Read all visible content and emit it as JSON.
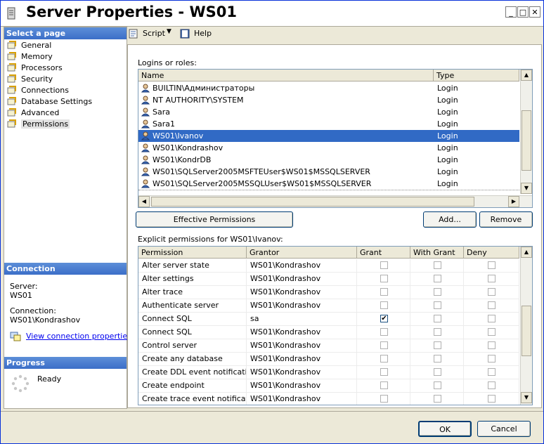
{
  "window": {
    "title": "Server Properties - WS01",
    "controls": {
      "minimize": "_",
      "maximize": "□",
      "close": "✕"
    }
  },
  "left": {
    "select_page_header": "Select a page",
    "pages": [
      {
        "label": "General",
        "icon": "properties-page-icon",
        "selected": false
      },
      {
        "label": "Memory",
        "icon": "properties-page-icon",
        "selected": false
      },
      {
        "label": "Processors",
        "icon": "properties-page-icon",
        "selected": false
      },
      {
        "label": "Security",
        "icon": "properties-page-icon",
        "selected": false
      },
      {
        "label": "Connections",
        "icon": "properties-page-icon",
        "selected": false
      },
      {
        "label": "Database Settings",
        "icon": "properties-page-icon",
        "selected": false
      },
      {
        "label": "Advanced",
        "icon": "properties-page-icon",
        "selected": false
      },
      {
        "label": "Permissions",
        "icon": "properties-page-icon",
        "selected": true
      }
    ],
    "connection": {
      "header": "Connection",
      "server_label": "Server:",
      "server_value": "WS01",
      "connection_label": "Connection:",
      "connection_value": "WS01\\Kondrashov",
      "view_link": "View connection properties"
    },
    "progress": {
      "header": "Progress",
      "status": "Ready"
    }
  },
  "toolbar": {
    "script_label": "Script",
    "help_label": "Help"
  },
  "logins": {
    "label": "Logins or roles:",
    "columns": [
      "Name",
      "Type"
    ],
    "rows": [
      {
        "name": "BUILTIN\\Администраторы",
        "type": "Login"
      },
      {
        "name": "NT AUTHORITY\\SYSTEM",
        "type": "Login"
      },
      {
        "name": "Sara",
        "type": "Login"
      },
      {
        "name": "Sara1",
        "type": "Login"
      },
      {
        "name": "WS01\\Ivanov",
        "type": "Login",
        "selected": true
      },
      {
        "name": "WS01\\Kondrashov",
        "type": "Login"
      },
      {
        "name": "WS01\\KondrDB",
        "type": "Login"
      },
      {
        "name": "WS01\\SQLServer2005MSFTEUser$WS01$MSSQLSERVER",
        "type": "Login"
      },
      {
        "name": "WS01\\SQLServer2005MSSQLUser$WS01$MSSQLSERVER",
        "type": "Login"
      }
    ]
  },
  "buttons": {
    "effective": "Effective Permissions",
    "add": "Add...",
    "remove": "Remove",
    "ok": "OK",
    "cancel": "Cancel"
  },
  "permissions": {
    "label": "Explicit permissions for WS01\\Ivanov:",
    "columns": [
      "Permission",
      "Grantor",
      "Grant",
      "With Grant",
      "Deny"
    ],
    "rows": [
      {
        "permission": "Alter server state",
        "grantor": "WS01\\Kondrashov",
        "grant": false,
        "with_grant": false,
        "deny": false
      },
      {
        "permission": "Alter settings",
        "grantor": "WS01\\Kondrashov",
        "grant": false,
        "with_grant": false,
        "deny": false
      },
      {
        "permission": "Alter trace",
        "grantor": "WS01\\Kondrashov",
        "grant": false,
        "with_grant": false,
        "deny": false
      },
      {
        "permission": "Authenticate server",
        "grantor": "WS01\\Kondrashov",
        "grant": false,
        "with_grant": false,
        "deny": false
      },
      {
        "permission": "Connect SQL",
        "grantor": "sa",
        "grant": true,
        "with_grant": false,
        "deny": false
      },
      {
        "permission": "Connect SQL",
        "grantor": "WS01\\Kondrashov",
        "grant": false,
        "with_grant": false,
        "deny": false
      },
      {
        "permission": "Control server",
        "grantor": "WS01\\Kondrashov",
        "grant": false,
        "with_grant": false,
        "deny": false
      },
      {
        "permission": "Create any database",
        "grantor": "WS01\\Kondrashov",
        "grant": false,
        "with_grant": false,
        "deny": false
      },
      {
        "permission": "Create DDL event notification",
        "grantor": "WS01\\Kondrashov",
        "grant": false,
        "with_grant": false,
        "deny": false
      },
      {
        "permission": "Create endpoint",
        "grantor": "WS01\\Kondrashov",
        "grant": false,
        "with_grant": false,
        "deny": false
      },
      {
        "permission": "Create trace event notificati...",
        "grantor": "WS01\\Kondrashov",
        "grant": false,
        "with_grant": false,
        "deny": false
      }
    ]
  }
}
